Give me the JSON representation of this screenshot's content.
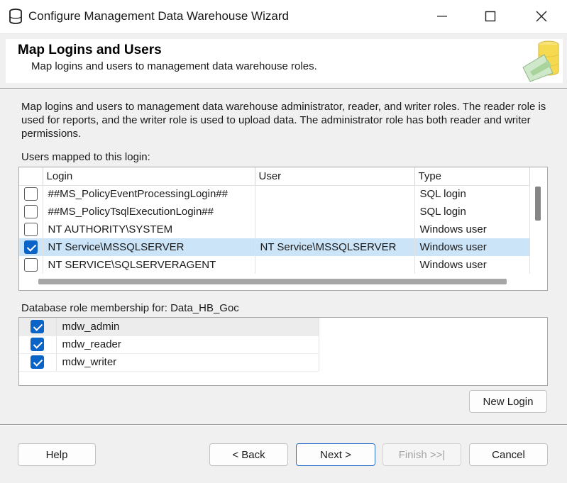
{
  "window": {
    "title": "Configure Management Data Warehouse Wizard",
    "icons": [
      "database-icon",
      "minimize-icon",
      "maximize-icon",
      "close-icon"
    ]
  },
  "header": {
    "title": "Map Logins and Users",
    "subtitle": "Map logins and users to management data warehouse roles."
  },
  "description": "Map logins and users to management data warehouse administrator, reader, and writer roles. The reader role is used for reports, and the writer role is used to upload data. The administrator role has both reader and writer permissions.",
  "users_grid": {
    "label": "Users mapped to this login:",
    "columns": [
      "Login",
      "User",
      "Type"
    ],
    "rows": [
      {
        "checked": false,
        "login": "##MS_PolicyEventProcessingLogin##",
        "user": "",
        "type": "SQL login"
      },
      {
        "checked": false,
        "login": "##MS_PolicyTsqlExecutionLogin##",
        "user": "",
        "type": "SQL login"
      },
      {
        "checked": false,
        "login": "NT AUTHORITY\\SYSTEM",
        "user": "",
        "type": "Windows user"
      },
      {
        "checked": true,
        "selected": true,
        "login": "NT Service\\MSSQLSERVER",
        "user": "NT Service\\MSSQLSERVER",
        "type": "Windows user"
      },
      {
        "checked": false,
        "login": "NT SERVICE\\SQLSERVERAGENT",
        "user": "",
        "type": "Windows user"
      }
    ]
  },
  "roles": {
    "label": "Database role membership for: Data_HB_Goc",
    "items": [
      {
        "checked": true,
        "name": "mdw_admin"
      },
      {
        "checked": true,
        "name": "mdw_reader"
      },
      {
        "checked": true,
        "name": "mdw_writer"
      }
    ]
  },
  "buttons": {
    "new_login": "New Login",
    "help": "Help",
    "back": "< Back",
    "next": "Next >",
    "finish": "Finish >>|",
    "cancel": "Cancel"
  },
  "colors": {
    "selection": "#cce4f7",
    "checkbox_checked": "#0a64c8",
    "primary_border": "#2c6fc9"
  }
}
